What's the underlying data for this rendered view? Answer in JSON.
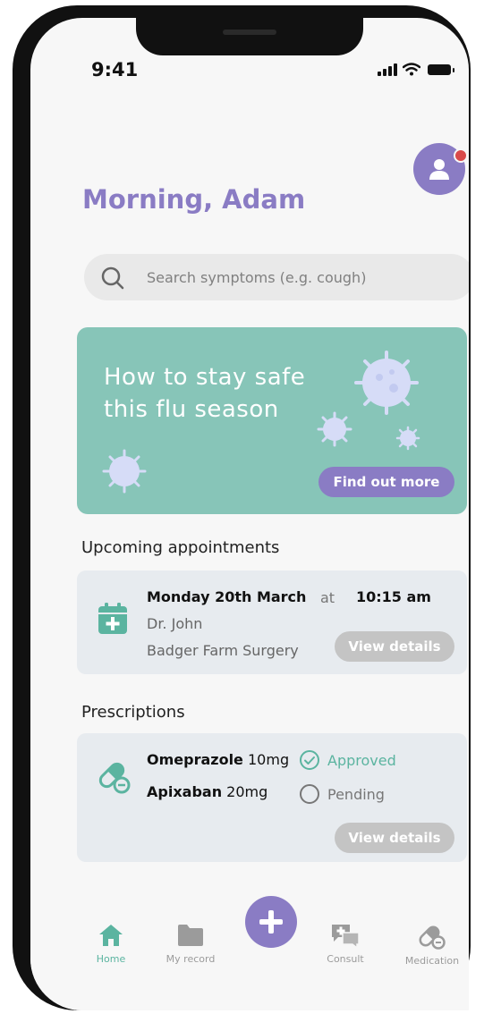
{
  "status_bar": {
    "time": "9:41"
  },
  "header": {
    "greeting": "Morning, Adam"
  },
  "search": {
    "placeholder": "Search symptoms (e.g. cough)"
  },
  "banner": {
    "title": "How to stay safe this flu season",
    "button_label": "Find out more",
    "color": "#87c5b8"
  },
  "appointments": {
    "title": "Upcoming appointments",
    "date": "Monday 20th March",
    "at_label": "at",
    "time": "10:15 am",
    "doctor": "Dr. John",
    "surgery": "Badger Farm Surgery",
    "view_details": "View details"
  },
  "prescriptions": {
    "title": "Prescriptions",
    "items": [
      {
        "name": "Omeprazole",
        "dose": "10mg",
        "status": "Approved"
      },
      {
        "name": "Apixaban",
        "dose": "20mg",
        "status": "Pending"
      }
    ],
    "view_details": "View details"
  },
  "nav": {
    "items": [
      {
        "label": "Home",
        "icon": "home-icon",
        "active": true
      },
      {
        "label": "My record",
        "icon": "folder-icon"
      },
      {
        "label": "",
        "icon": "plus-icon"
      },
      {
        "label": "Consult",
        "icon": "chat-medical-icon"
      },
      {
        "label": "Medication",
        "icon": "pill-icon"
      }
    ]
  },
  "colors": {
    "accent": "#8a7cc4",
    "teal": "#87c5b8",
    "card": "#e7ebef",
    "approved": "#5bb4a0",
    "notification": "#d94a4a"
  }
}
